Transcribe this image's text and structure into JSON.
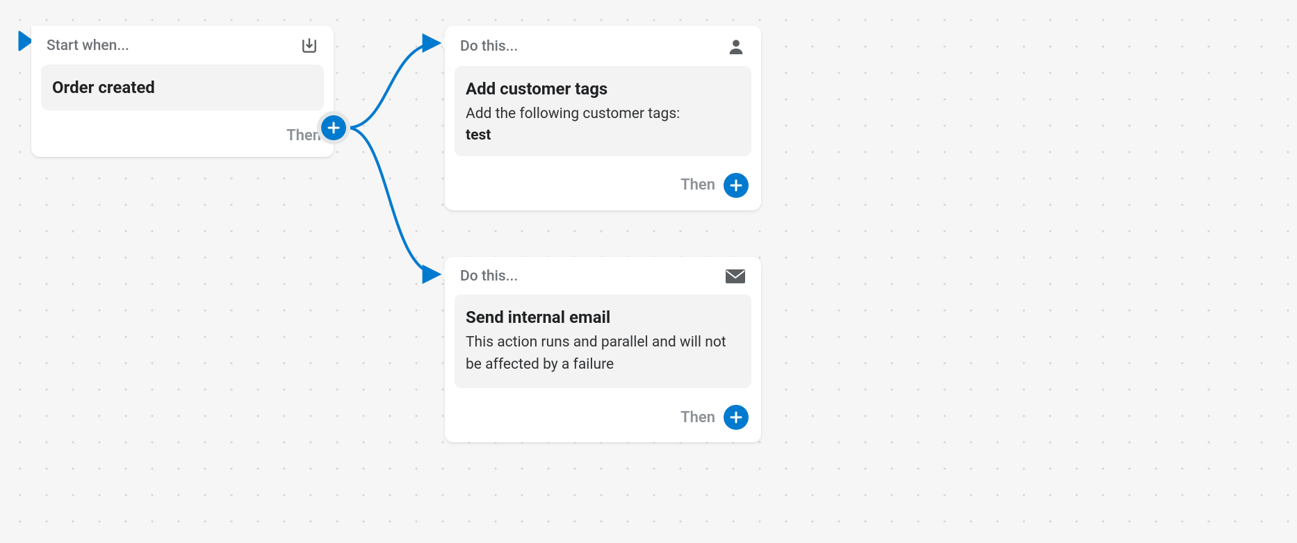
{
  "trigger": {
    "header_label": "Start when...",
    "title": "Order created",
    "then_label": "Then",
    "icon_name": "download-box-icon"
  },
  "action1": {
    "header_label": "Do this...",
    "title": "Add customer tags",
    "description": "Add the following customer tags:",
    "tag_value": "test",
    "then_label": "Then",
    "icon_name": "user-icon"
  },
  "action2": {
    "header_label": "Do this...",
    "title": "Send internal email",
    "description": "This action runs and parallel and will not be affected by a failure",
    "then_label": "Then",
    "icon_name": "mail-icon"
  },
  "colors": {
    "accent": "#007ace"
  }
}
